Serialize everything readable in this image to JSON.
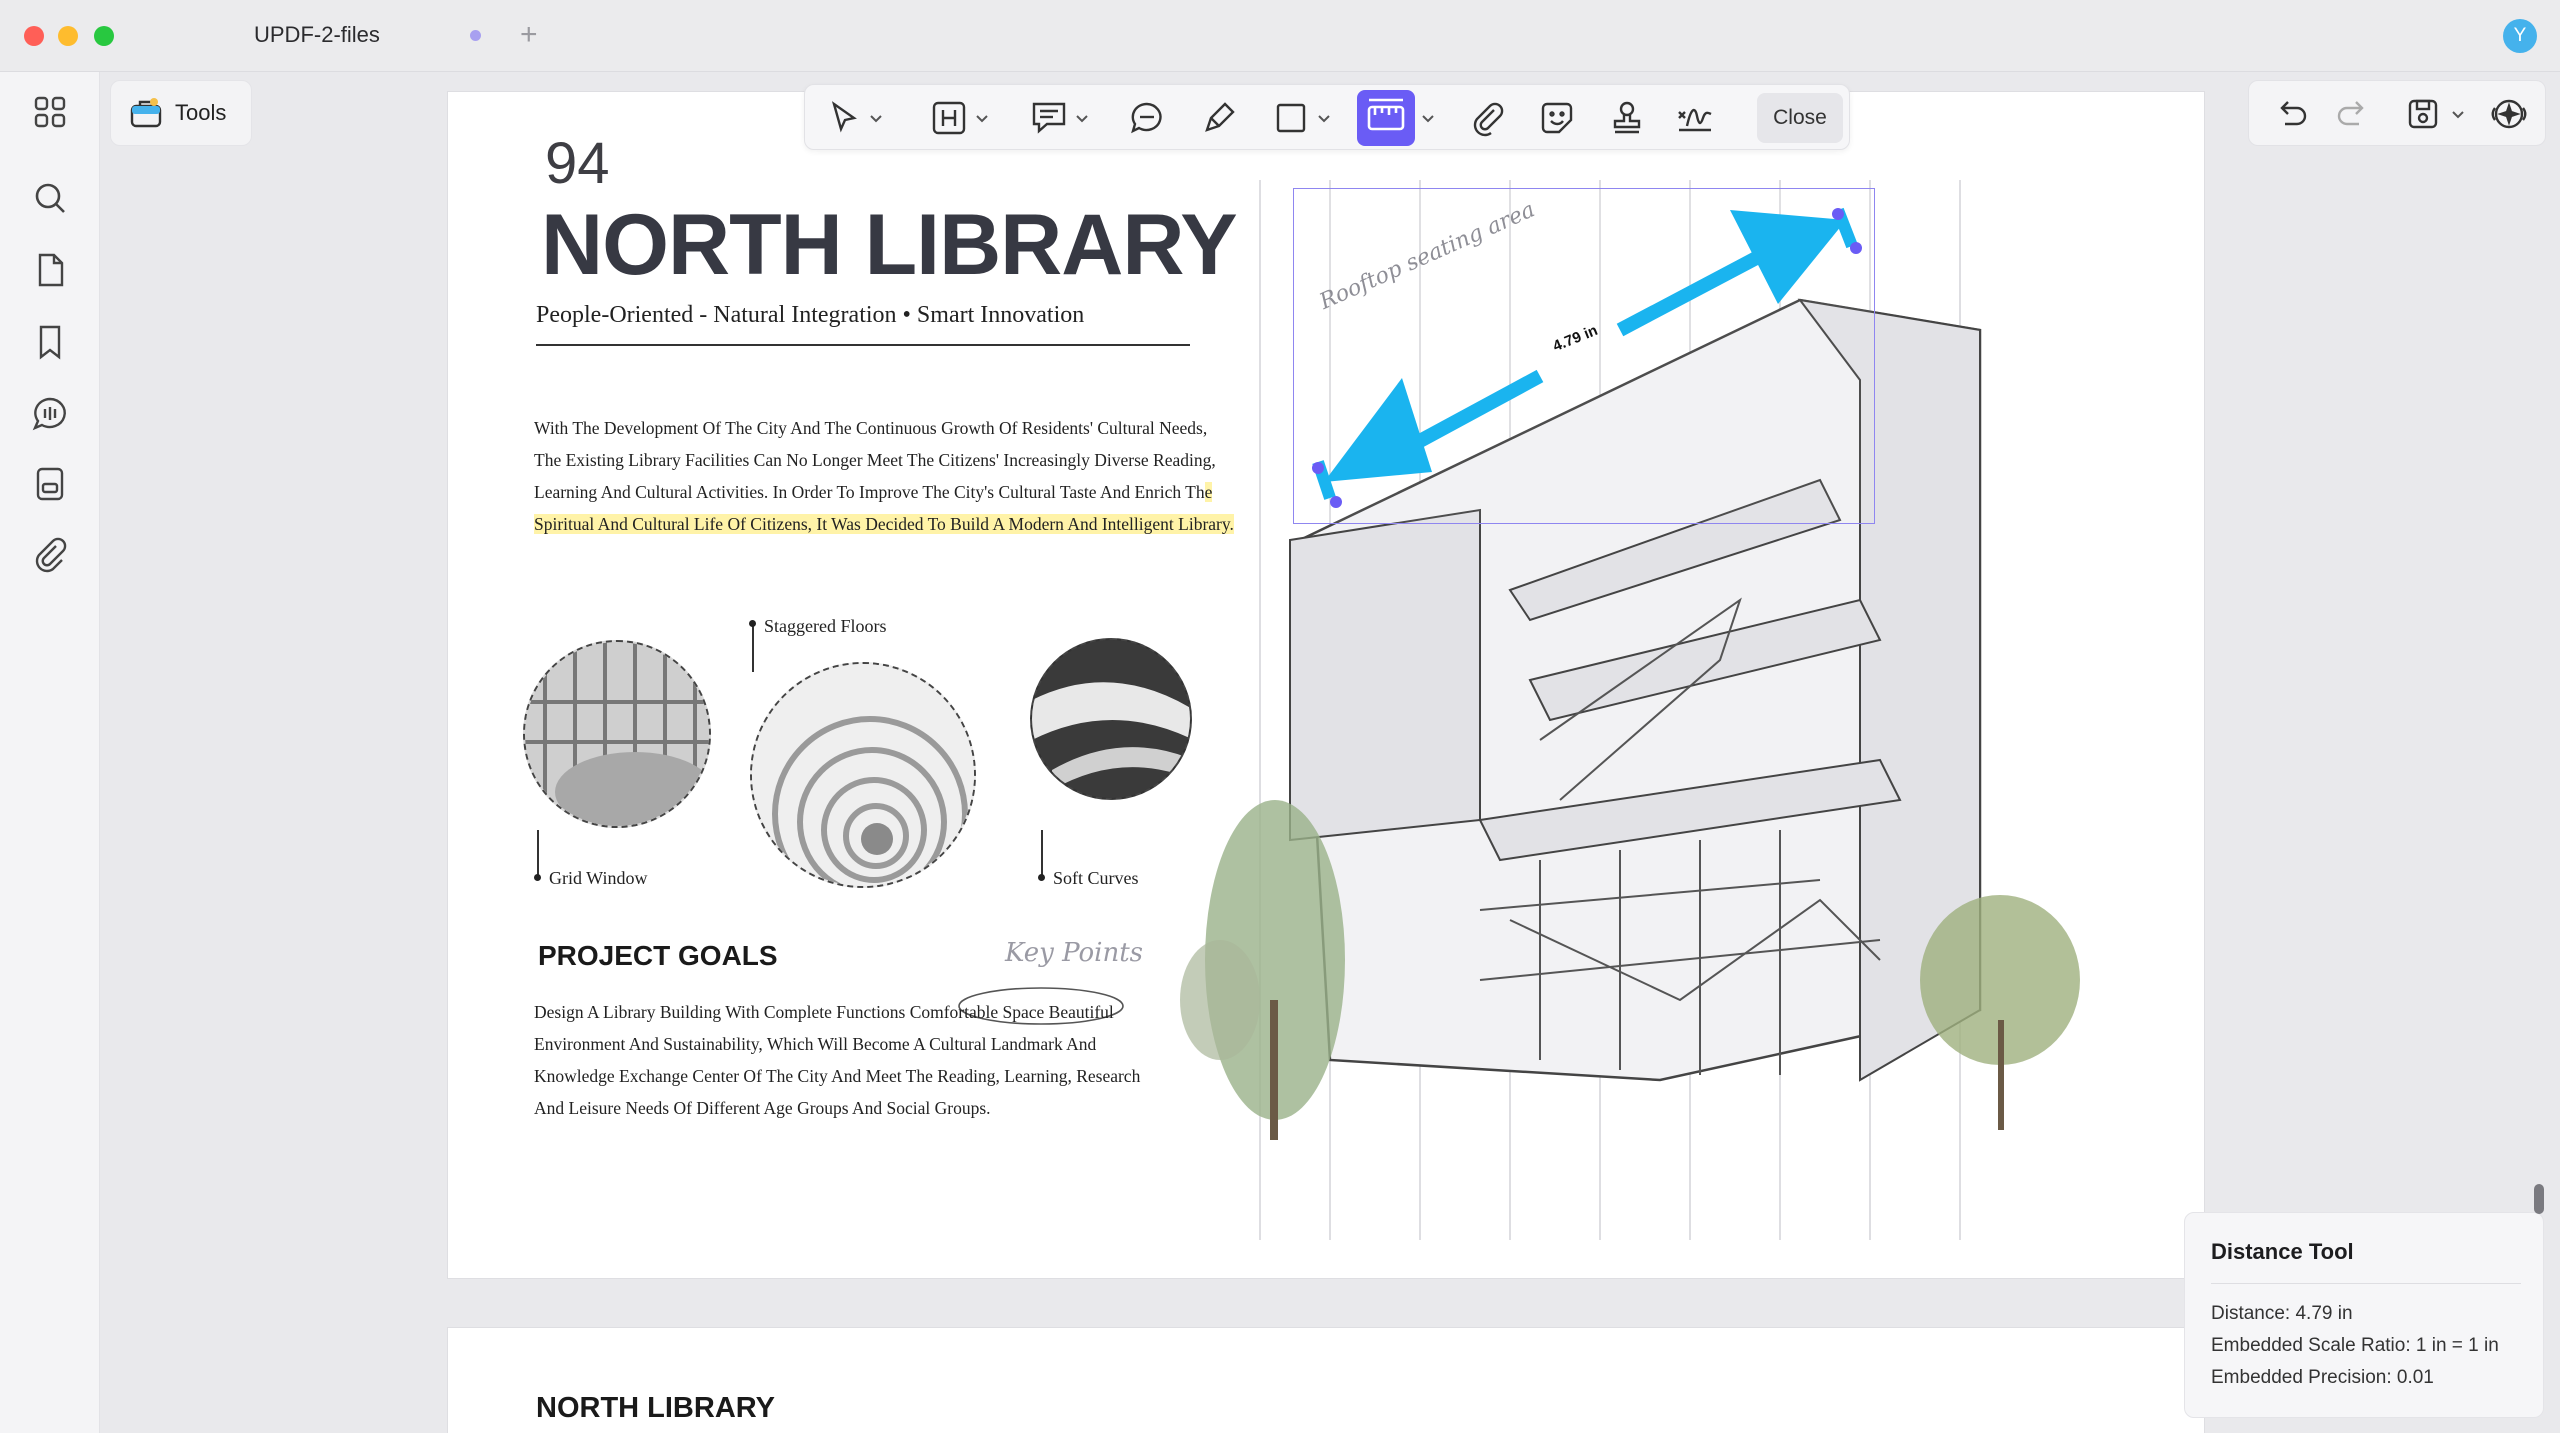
{
  "window": {
    "tab_title": "UPDF-2-files",
    "avatar_initial": "Y"
  },
  "tools_button": {
    "label": "Tools"
  },
  "sidebar": {
    "items": [
      "apps-grid-icon",
      "search-icon",
      "pages-icon",
      "bookmark-icon",
      "comment-icon",
      "forms-icon",
      "attachment-icon"
    ]
  },
  "annotation_toolbar": {
    "close_label": "Close",
    "active_tool": "measure-icon",
    "accent": "#6a5cf5"
  },
  "page": {
    "number": "94",
    "title": "NORTH LIBRARY",
    "subtitle": "People-Oriented - Natural Integration • Smart Innovation",
    "intro_normal": "With The Development Of The City And The Continuous Growth Of Residents' Cultural Needs, The Existing Library Facilities Can No Longer Meet The Citizens' Increasingly Diverse Reading, Learning And Cultural Activities. In Order To Improve The City's Cultural Taste And Enrich Th",
    "intro_highlight": "e Spiritual And Cultural Life Of Citizens, It Was Decided To Build A Modern And Intelligent Library.",
    "captions": {
      "grid_window": "Grid Window",
      "staggered_floors": "Staggered Floors",
      "soft_curves": "Soft Curves"
    },
    "goals_title": "PROJECT GOALS",
    "key_points": "Key Points",
    "goals_body": "Design A Library Building With Complete Functions Comfortable Space Beautiful Environment And Sustainability, Which Will Become A Cultural Landmark And Knowledge Exchange Center Of The City And Meet The Reading, Learning, Research And Leisure Needs Of Different Age Groups And Social Groups.",
    "sketch_label": "Rooftop seating area",
    "measure_label": "4.79 in",
    "measure_color": "#1ab4ef",
    "highlight_color": "#fff3a8"
  },
  "page2": {
    "title": "NORTH LIBRARY"
  },
  "distance_panel": {
    "title": "Distance Tool",
    "distance": "Distance: 4.79 in",
    "scale": "Embedded Scale Ratio: 1 in = 1 in",
    "precision": "Embedded Precision: 0.01"
  }
}
